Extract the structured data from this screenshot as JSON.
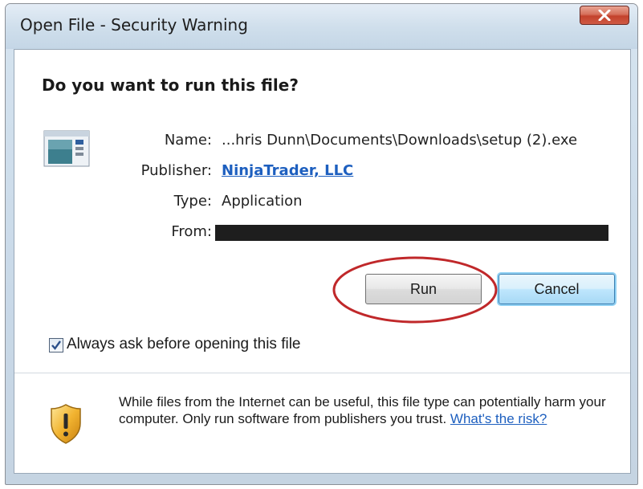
{
  "window": {
    "title": "Open File - Security Warning"
  },
  "dialog": {
    "heading": "Do you want to run this file?",
    "fields": {
      "name_label": "Name:",
      "name_value": "...hris Dunn\\Documents\\Downloads\\setup (2).exe",
      "publisher_label": "Publisher:",
      "publisher_value": "NinjaTrader, LLC",
      "type_label": "Type:",
      "type_value": "Application",
      "from_label": "From:"
    },
    "buttons": {
      "run": "Run",
      "cancel": "Cancel"
    },
    "checkbox": {
      "label": "Always ask before opening this file",
      "checked": true
    },
    "warning": {
      "text": "While files from the Internet can be useful, this file type can potentially harm your computer. Only run software from publishers you trust.",
      "link": "What's the risk?"
    }
  },
  "icons": {
    "close": "close-icon",
    "file": "application-file-icon",
    "shield": "warning-shield-icon",
    "check": "checkmark-icon"
  },
  "colors": {
    "link": "#1d5fbf",
    "highlight_circle": "#c0282a",
    "close_button": "#c3422c"
  }
}
